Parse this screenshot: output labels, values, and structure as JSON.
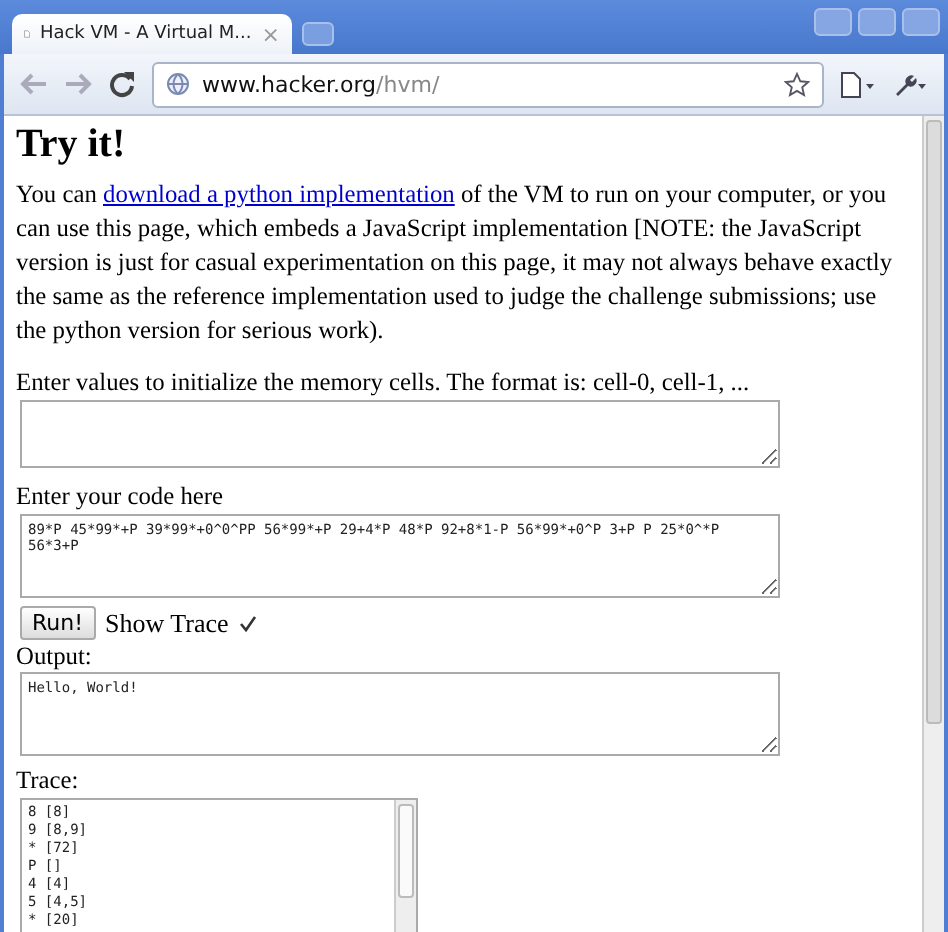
{
  "window": {
    "tab_title": "Hack VM - A Virtual M...",
    "tab_close": "×"
  },
  "toolbar": {
    "url_host": "www.hacker.org",
    "url_path": "/hvm/"
  },
  "page": {
    "heading": "Try it!",
    "intro_before": "You can ",
    "intro_link": "download a python implementation",
    "intro_after": " of the VM to run on your computer, or you can use this page, which embeds a JavaScript implementation [NOTE: the JavaScript version is just for casual experimentation on this page, it may not always behave exactly the same as the reference implementation used to judge the challenge submissions; use the python version for serious work).",
    "memory_label": "Enter values to initialize the memory cells. The format is: cell-0, cell-1, ...",
    "code_label": "Enter your code here",
    "code": "89*P 45*99*+P 39*99*+0^0^PP 56*99*+P 29+4*P 48*P 92+8*1-P 56*99*+0^P 3+P P 25*0^*P 56*3+P",
    "run_button": "Run!",
    "show_trace_label": "Show Trace",
    "show_trace": {
      "checked": true
    },
    "output_label": "Output:",
    "output": "Hello, World!",
    "trace_label": "Trace:",
    "trace_lines": [
      "8 [8]",
      "9 [8,9]",
      "* [72]",
      "P []",
      "4 [4]",
      "5 [4,5]",
      "* [20]"
    ]
  }
}
